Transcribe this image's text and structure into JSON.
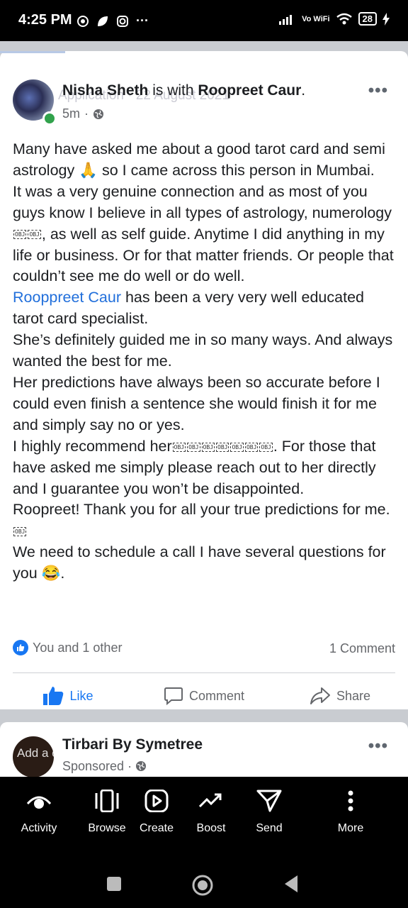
{
  "status": {
    "time": "4:25 PM",
    "network": "Vo WiFi",
    "battery": "28"
  },
  "post": {
    "author": "Nisha Sheth",
    "with_text": "is with",
    "tagged": "Roopreet Caur",
    "period": ".",
    "time": "5m",
    "overlay_text": "Application · 22 August 2021",
    "body": {
      "p1": "Many have asked me about a good tarot card and semi astrology 🙏 so I came across this person in Mumbai.",
      "p2a": "It was a very genuine connection and as most of you guys know I believe in all types of astrology, numerology",
      "p2b": ", as well as self guide. Anytime I did anything in my life or business. Or for that matter friends. Or people that couldn’t see me do well or do well.",
      "mention": "Rooppreet Caur",
      "p3b": " has been a very very well educated tarot card specialist.",
      "p4": "She’s definitely guided me in so many ways. And always wanted the best for me.",
      "p5": "Her predictions have always been so accurate before I could even finish a sentence she would finish it for me and simply say no or yes.",
      "p6a": "I highly recommend her",
      "p6b": ". For those that have asked me simply please reach out to her directly and I guarantee you won’t be disappointed.",
      "p7a": "Roopreet! Thank you for all your true predictions for me.",
      "p8": "We need to schedule a call I have several questions for you 😂."
    },
    "obj_label": "OBJ",
    "reactions_text": "You and 1 other",
    "comments_text": "1 Comment",
    "actions": {
      "like": "Like",
      "comment": "Comment",
      "share": "Share"
    }
  },
  "next_post": {
    "author": "Tirbari By Symetree",
    "sub": "Sponsored",
    "overlay_text": "Add a comment..."
  },
  "bottom_nav": [
    {
      "label": "Activity"
    },
    {
      "label": "Browse"
    },
    {
      "label": "Create"
    },
    {
      "label": "Boost"
    },
    {
      "label": "Send"
    },
    {
      "label": "More"
    }
  ],
  "colors": {
    "accent": "#1877f2",
    "mention": "#216fdb",
    "online": "#31a24c"
  }
}
